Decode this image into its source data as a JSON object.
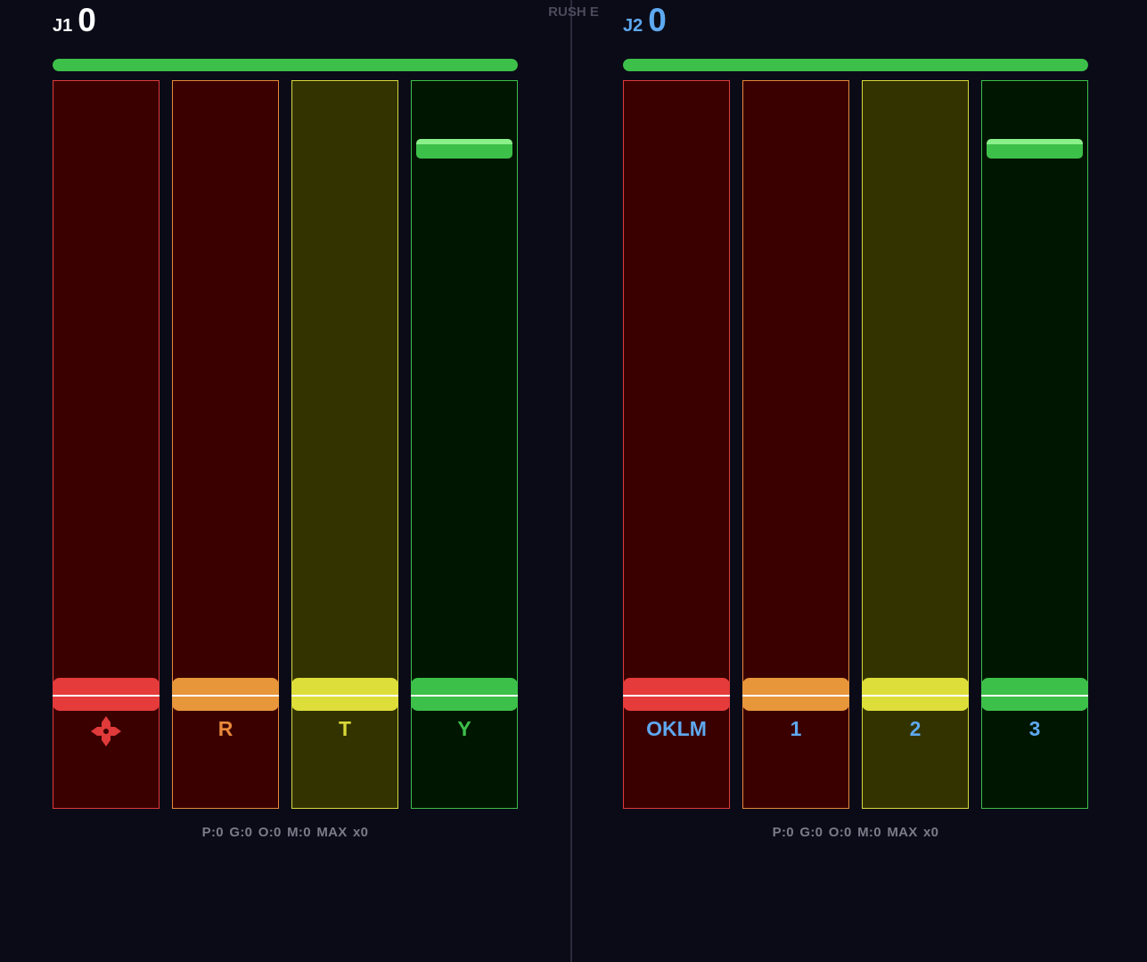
{
  "song": {
    "title": "RUSH E"
  },
  "players": [
    {
      "label": "J1",
      "score": "0",
      "life_fraction": 1.0,
      "label_color": "#ffffff",
      "keys": [
        "dpad-icon",
        "R",
        "T",
        "Y"
      ],
      "stats": "P:0  G:0  O:0  M:0  MAX x0"
    },
    {
      "label": "J2",
      "score": "0",
      "life_fraction": 1.0,
      "label_color": "#5ea8f0",
      "keys": [
        "OKLM",
        "1",
        "2",
        "3"
      ],
      "stats": "P:0  G:0  O:0  M:0  MAX x0"
    }
  ],
  "lane_colors": {
    "red": {
      "border": "#e03a3a",
      "bg": "#3a0000",
      "receptor": "#e63b3b"
    },
    "orange": {
      "border": "#e8883a",
      "bg": "#3a0000",
      "receptor": "#e8963a"
    },
    "yellow": {
      "border": "#d8d83a",
      "bg": "#333300",
      "receptor": "#dede3a"
    },
    "green": {
      "border": "#3dc04a",
      "bg": "#001600",
      "receptor": "#3dc04a"
    }
  }
}
